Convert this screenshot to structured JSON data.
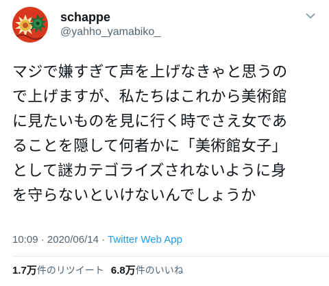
{
  "user": {
    "display_name": "schappe",
    "handle": "@yahho_yamabiko_"
  },
  "icons": {
    "menu": "chevron-down-icon",
    "avatar": "flower-illustration-avatar"
  },
  "colors": {
    "avatar_bg": "#d9381e",
    "source_link": "#1d9bf0"
  },
  "tweet": {
    "lines": [
      "マジで嫌すぎて声を上げなきゃと思うの",
      "で上げますが、私たちはこれから美術館",
      "に見たいものを見に行く時でさえ女であ",
      "ることを隠して何者かに「美術館女子」",
      "として謎カテゴライズされないように身",
      "を守らないといけないんでしょうか"
    ]
  },
  "meta": {
    "time": "10:09",
    "sep1": " · ",
    "date": "2020/06/14",
    "sep2": " · ",
    "source": "Twitter Web App"
  },
  "stats": {
    "retweets_num": "1.7万",
    "retweets_label": "件のリツイート",
    "likes_num": "6.8万",
    "likes_label": "件のいいね"
  }
}
